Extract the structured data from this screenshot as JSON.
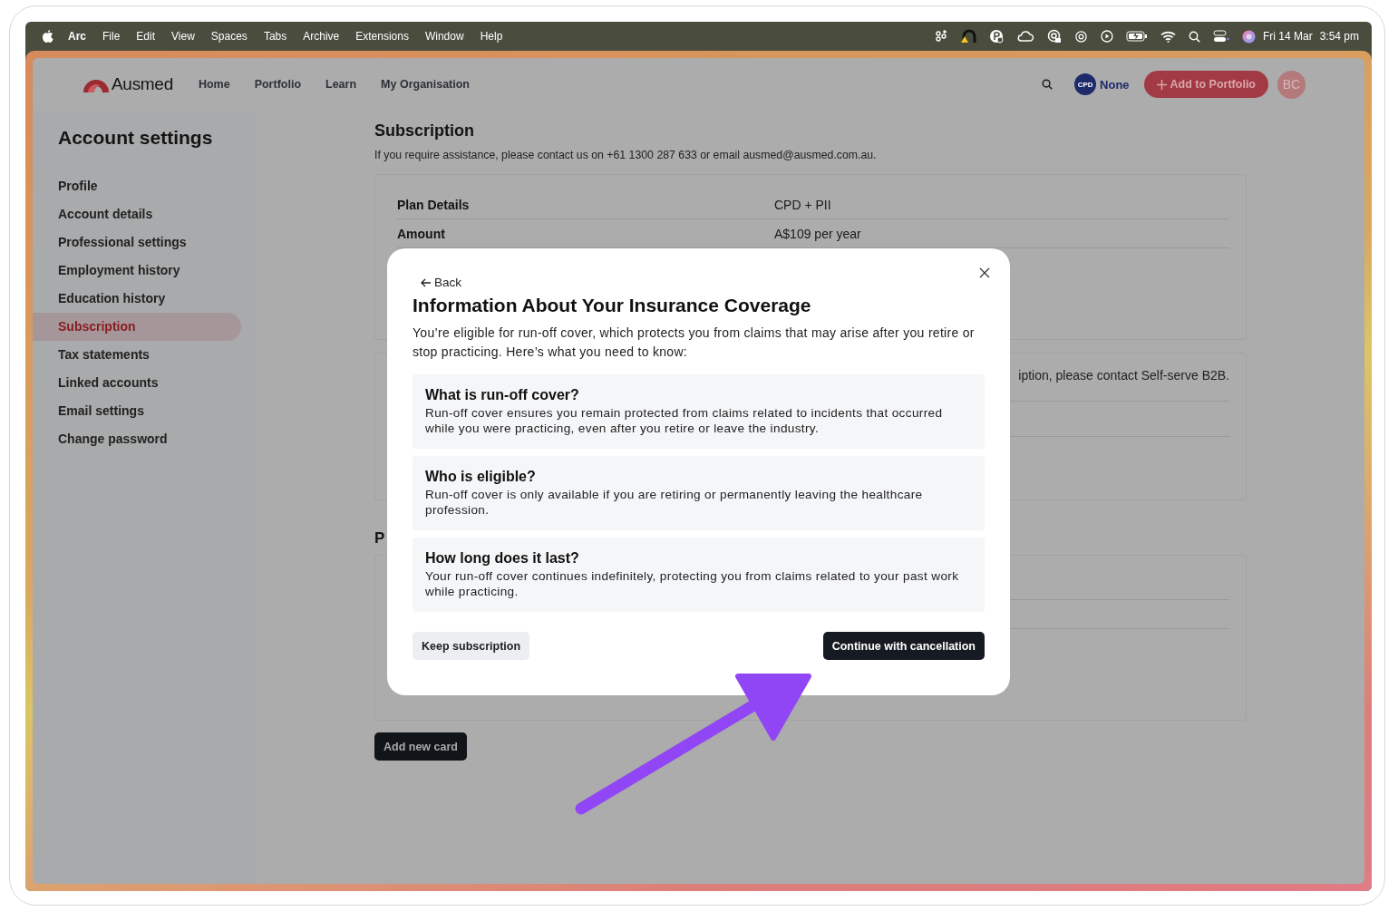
{
  "menu_bar": {
    "app": "Arc",
    "menus": [
      "File",
      "Edit",
      "View",
      "Spaces",
      "Tabs",
      "Archive",
      "Extensions",
      "Window",
      "Help"
    ],
    "date": "Fri 14 Mar",
    "time": "3:54 pm"
  },
  "header": {
    "logo": "Ausmed",
    "nav": [
      {
        "label": "Home"
      },
      {
        "label": "Portfolio"
      },
      {
        "label": "Learn"
      },
      {
        "label": "My Organisation"
      }
    ],
    "cpd_badge": "CPD",
    "cpd_status": "None",
    "add_button": "Add to Portfolio",
    "avatar": "BC"
  },
  "sidebar": {
    "title": "Account settings",
    "items": [
      {
        "label": "Profile",
        "selected": false
      },
      {
        "label": "Account details",
        "selected": false
      },
      {
        "label": "Professional settings",
        "selected": false
      },
      {
        "label": "Employment history",
        "selected": false
      },
      {
        "label": "Education history",
        "selected": false
      },
      {
        "label": "Subscription",
        "selected": true
      },
      {
        "label": "Tax statements",
        "selected": false
      },
      {
        "label": "Linked accounts",
        "selected": false
      },
      {
        "label": "Email settings",
        "selected": false
      },
      {
        "label": "Change password",
        "selected": false
      }
    ]
  },
  "subscription": {
    "title": "Subscription",
    "note": "If you require assistance, please contact us on +61 1300 287 633 or email ausmed@ausmed.com.au.",
    "plan_rows": [
      {
        "label": "Plan Details",
        "value": "CPD + PII"
      },
      {
        "label": "Amount",
        "value": "A$109 per year"
      }
    ],
    "notice": "iption, please contact Self-serve B2B.",
    "payment_heading": "P",
    "add_card_button": "Add new card"
  },
  "modal": {
    "back": "Back",
    "title": "Information About Your Insurance Coverage",
    "intro": "You’re eligible for run-off cover, which protects you from claims that may arise after you retire or stop practicing. Here’s what you need to know:",
    "sections": [
      {
        "heading": "What is run-off cover?",
        "body": "Run-off cover ensures you remain protected from claims related to incidents that occurred while you were practicing, even after you retire or leave the industry."
      },
      {
        "heading": "Who is eligible?",
        "body": "Run-off cover is only available if you are retiring or permanently leaving the healthcare profession."
      },
      {
        "heading": "How long does it last?",
        "body": "Your run-off cover continues indefinitely, protecting you from claims related to your past work while practicing."
      }
    ],
    "keep_button": "Keep subscription",
    "continue_button": "Continue with cancellation"
  }
}
